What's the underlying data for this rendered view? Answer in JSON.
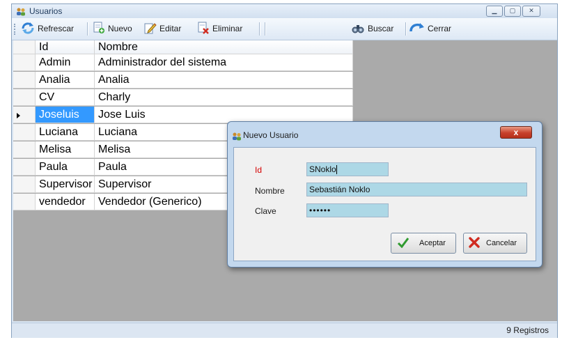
{
  "window": {
    "title": "Usuarios",
    "controls": [
      "minimize",
      "maximize",
      "close"
    ]
  },
  "toolbar": {
    "refresh_label": "Refrescar",
    "new_label": "Nuevo",
    "edit_label": "Editar",
    "delete_label": "Eliminar",
    "search_label": "Buscar",
    "close_label": "Cerrar"
  },
  "grid": {
    "columns": [
      "Id",
      "Nombre"
    ],
    "selected_index": 3,
    "rows": [
      {
        "id": "Admin",
        "name": "Administrador del sistema"
      },
      {
        "id": "Analia",
        "name": "Analia"
      },
      {
        "id": "CV",
        "name": "Charly"
      },
      {
        "id": "Joseluis",
        "name": "Jose Luis"
      },
      {
        "id": "Luciana",
        "name": "Luciana"
      },
      {
        "id": "Melisa",
        "name": "Melisa"
      },
      {
        "id": "Paula",
        "name": "Paula"
      },
      {
        "id": "Supervisor",
        "name": "Supervisor"
      },
      {
        "id": "vendedor",
        "name": "Vendedor (Generico)"
      }
    ]
  },
  "status": {
    "count_text": "9 Registros"
  },
  "dialog": {
    "title": "Nuevo Usuario",
    "close_glyph": "x",
    "id_label": "Id",
    "id_value": "SNoklo",
    "name_label": "Nombre",
    "name_value": "Sebastián Noklo",
    "password_label": "Clave",
    "password_value": "••••••",
    "accept_label": "Aceptar",
    "cancel_label": "Cancelar"
  },
  "colors": {
    "selection": "#3399ff",
    "field_bg": "#add8e6",
    "required_label": "#d40000",
    "workspace": "#aaaaaa"
  }
}
